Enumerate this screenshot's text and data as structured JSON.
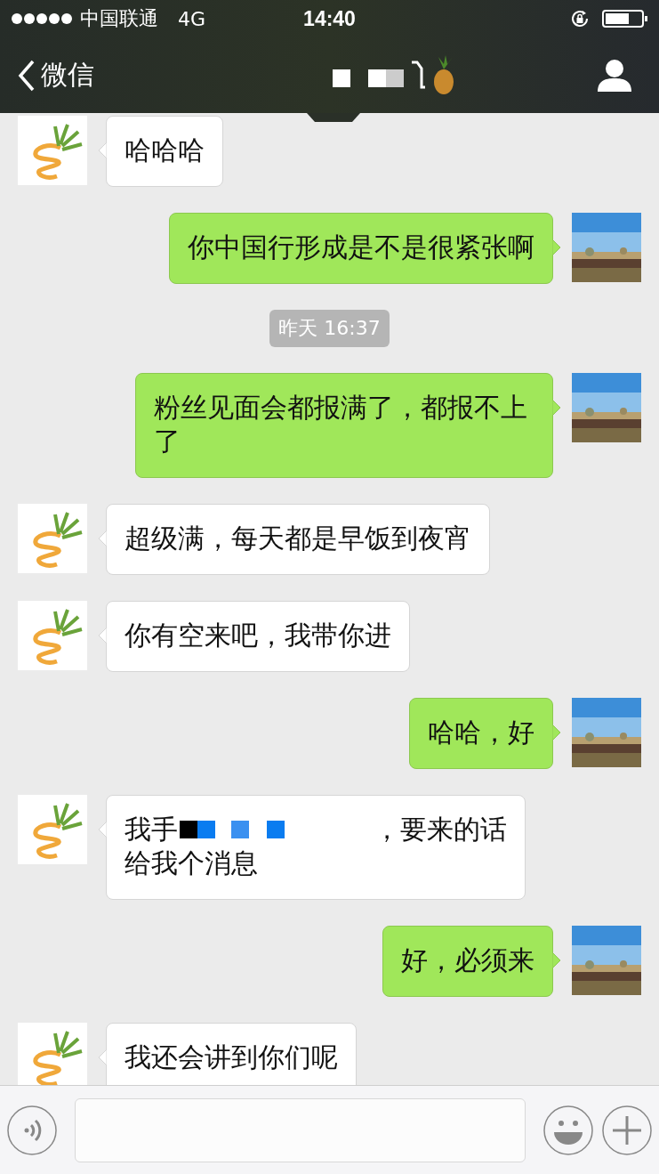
{
  "status_bar": {
    "carrier": "中国联通",
    "network": "4G",
    "time": "14:40"
  },
  "nav": {
    "back_label": "微信"
  },
  "messages": [
    {
      "kind": "incoming",
      "text": "哈哈哈"
    },
    {
      "kind": "outgoing",
      "text": "你中国行形成是不是很紧张啊"
    },
    {
      "kind": "time",
      "text": "昨天 16:37"
    },
    {
      "kind": "outgoing",
      "text": "粉丝见面会都报满了，都报不上了"
    },
    {
      "kind": "incoming",
      "text": "超级满，每天都是早饭到夜宵"
    },
    {
      "kind": "incoming",
      "text": "你有空来吧，我带你进"
    },
    {
      "kind": "outgoing",
      "text": "哈哈，好"
    },
    {
      "kind": "incoming_redacted",
      "before": "我手",
      "after": "，要来的话",
      "line2": "给我个消息"
    },
    {
      "kind": "outgoing",
      "text": "好，必须来"
    },
    {
      "kind": "incoming",
      "text": "我还会讲到你们呢"
    }
  ]
}
